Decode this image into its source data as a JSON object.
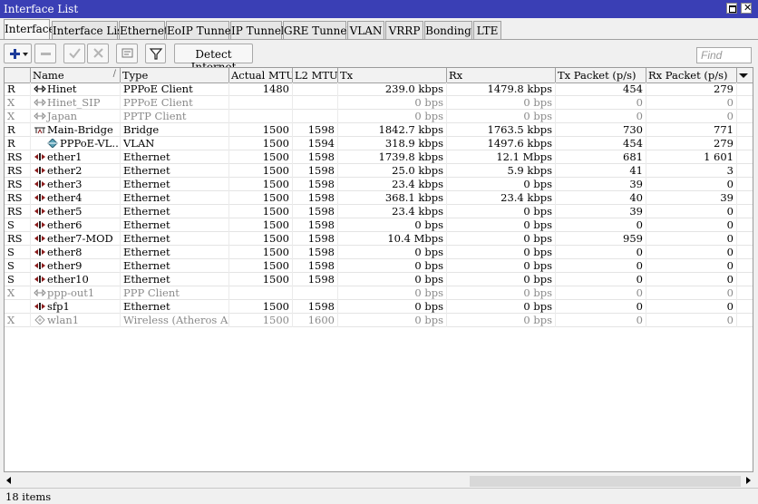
{
  "window": {
    "title": "Interface List"
  },
  "tabs": [
    "Interface",
    "Interface List",
    "Ethernet",
    "EoIP Tunnel",
    "IP Tunnel",
    "GRE Tunnel",
    "VLAN",
    "VRRP",
    "Bonding",
    "LTE"
  ],
  "toolbar": {
    "add_icon": "plus-dropdown-icon",
    "remove_icon": "minus-icon",
    "enable_icon": "check-icon",
    "disable_icon": "x-icon",
    "comment_icon": "comment-icon",
    "filter_icon": "filter-icon",
    "detect_label": "Detect Internet",
    "find_placeholder": "Find"
  },
  "columns": [
    "",
    "Name",
    "Type",
    "Actual MTU",
    "L2 MTU",
    "Tx",
    "Rx",
    "Tx Packet (p/s)",
    "Rx Packet (p/s)"
  ],
  "rows": [
    {
      "flag": "R",
      "name": "Hinet",
      "icon": "ppp",
      "type": "PPPoE Client",
      "mtu": "1480",
      "l2": "",
      "tx": "239.0 kbps",
      "rx": "1479.8 kbps",
      "txp": "454",
      "rxp": "279",
      "disabled": false
    },
    {
      "flag": "X",
      "name": "Hinet_SIP",
      "icon": "ppp",
      "type": "PPPoE Client",
      "mtu": "",
      "l2": "",
      "tx": "0 bps",
      "rx": "0 bps",
      "txp": "0",
      "rxp": "0",
      "disabled": true
    },
    {
      "flag": "X",
      "name": "Japan",
      "icon": "ppp",
      "type": "PPTP Client",
      "mtu": "",
      "l2": "",
      "tx": "0 bps",
      "rx": "0 bps",
      "txp": "0",
      "rxp": "0",
      "disabled": true
    },
    {
      "flag": "R",
      "name": "Main-Bridge",
      "icon": "bridge",
      "type": "Bridge",
      "mtu": "1500",
      "l2": "1598",
      "tx": "1842.7 kbps",
      "rx": "1763.5 kbps",
      "txp": "730",
      "rxp": "771",
      "disabled": false
    },
    {
      "flag": "R",
      "name": "PPPoE-VL…",
      "icon": "vlan",
      "type": "VLAN",
      "mtu": "1500",
      "l2": "1594",
      "tx": "318.9 kbps",
      "rx": "1497.6 kbps",
      "txp": "454",
      "rxp": "279",
      "disabled": false
    },
    {
      "flag": "RS",
      "name": "ether1",
      "icon": "eth",
      "type": "Ethernet",
      "mtu": "1500",
      "l2": "1598",
      "tx": "1739.8 kbps",
      "rx": "12.1 Mbps",
      "txp": "681",
      "rxp": "1 601",
      "disabled": false
    },
    {
      "flag": "RS",
      "name": "ether2",
      "icon": "eth",
      "type": "Ethernet",
      "mtu": "1500",
      "l2": "1598",
      "tx": "25.0 kbps",
      "rx": "5.9 kbps",
      "txp": "41",
      "rxp": "3",
      "disabled": false
    },
    {
      "flag": "RS",
      "name": "ether3",
      "icon": "eth",
      "type": "Ethernet",
      "mtu": "1500",
      "l2": "1598",
      "tx": "23.4 kbps",
      "rx": "0 bps",
      "txp": "39",
      "rxp": "0",
      "disabled": false
    },
    {
      "flag": "RS",
      "name": "ether4",
      "icon": "eth",
      "type": "Ethernet",
      "mtu": "1500",
      "l2": "1598",
      "tx": "368.1 kbps",
      "rx": "23.4 kbps",
      "txp": "40",
      "rxp": "39",
      "disabled": false
    },
    {
      "flag": "RS",
      "name": "ether5",
      "icon": "eth",
      "type": "Ethernet",
      "mtu": "1500",
      "l2": "1598",
      "tx": "23.4 kbps",
      "rx": "0 bps",
      "txp": "39",
      "rxp": "0",
      "disabled": false
    },
    {
      "flag": "S",
      "name": "ether6",
      "icon": "eth",
      "type": "Ethernet",
      "mtu": "1500",
      "l2": "1598",
      "tx": "0 bps",
      "rx": "0 bps",
      "txp": "0",
      "rxp": "0",
      "disabled": false
    },
    {
      "flag": "RS",
      "name": "ether7-MOD",
      "icon": "eth",
      "type": "Ethernet",
      "mtu": "1500",
      "l2": "1598",
      "tx": "10.4 Mbps",
      "rx": "0 bps",
      "txp": "959",
      "rxp": "0",
      "disabled": false
    },
    {
      "flag": "S",
      "name": "ether8",
      "icon": "eth",
      "type": "Ethernet",
      "mtu": "1500",
      "l2": "1598",
      "tx": "0 bps",
      "rx": "0 bps",
      "txp": "0",
      "rxp": "0",
      "disabled": false
    },
    {
      "flag": "S",
      "name": "ether9",
      "icon": "eth",
      "type": "Ethernet",
      "mtu": "1500",
      "l2": "1598",
      "tx": "0 bps",
      "rx": "0 bps",
      "txp": "0",
      "rxp": "0",
      "disabled": false
    },
    {
      "flag": "S",
      "name": "ether10",
      "icon": "eth",
      "type": "Ethernet",
      "mtu": "1500",
      "l2": "1598",
      "tx": "0 bps",
      "rx": "0 bps",
      "txp": "0",
      "rxp": "0",
      "disabled": false
    },
    {
      "flag": "X",
      "name": "ppp-out1",
      "icon": "ppp",
      "type": "PPP Client",
      "mtu": "",
      "l2": "",
      "tx": "0 bps",
      "rx": "0 bps",
      "txp": "0",
      "rxp": "0",
      "disabled": true
    },
    {
      "flag": "",
      "name": "sfp1",
      "icon": "eth",
      "type": "Ethernet",
      "mtu": "1500",
      "l2": "1598",
      "tx": "0 bps",
      "rx": "0 bps",
      "txp": "0",
      "rxp": "0",
      "disabled": false
    },
    {
      "flag": "X",
      "name": "wlan1",
      "icon": "wlan",
      "type": "Wireless (Atheros AR…",
      "mtu": "1500",
      "l2": "1600",
      "tx": "0 bps",
      "rx": "0 bps",
      "txp": "0",
      "rxp": "0",
      "disabled": true
    }
  ],
  "status": {
    "items_text": "18 items"
  },
  "colors": {
    "titlebar": "#3a3fb5",
    "icon_accent": "#8b1c1c",
    "disabled_text": "#8a8a8a"
  }
}
